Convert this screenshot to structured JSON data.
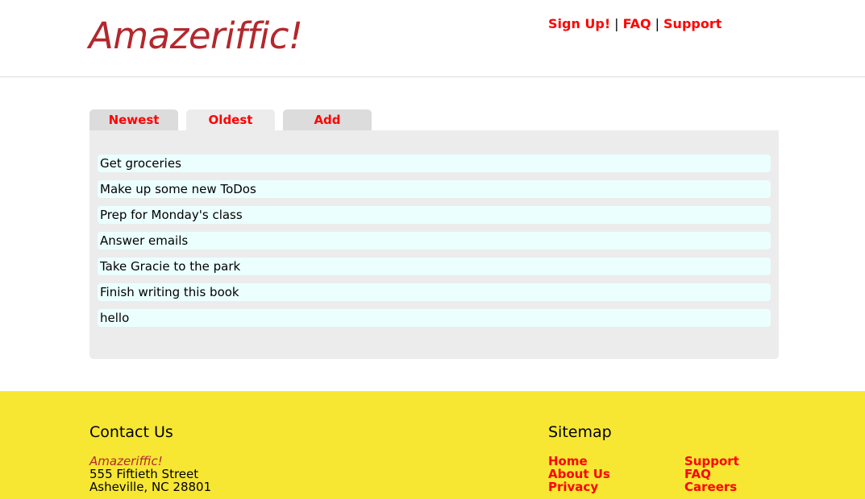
{
  "header": {
    "logo": "Amazeriffic!",
    "nav": {
      "signup": "Sign Up!",
      "separator": "|",
      "faq": "FAQ",
      "support": "Support"
    }
  },
  "tabs": [
    {
      "label": "Newest",
      "active": false
    },
    {
      "label": "Oldest",
      "active": true
    },
    {
      "label": "Add",
      "active": false
    }
  ],
  "todos": [
    "Get groceries",
    "Make up some new ToDos",
    "Prep for Monday's class",
    "Answer emails",
    "Take Gracie to the park",
    "Finish writing this book",
    "hello"
  ],
  "footer": {
    "contact": {
      "heading": "Contact Us",
      "brand": "Amazeriffic!",
      "street": "555 Fiftieth Street",
      "city": "Asheville, NC 28801"
    },
    "sitemap": {
      "heading": "Sitemap",
      "col1": [
        "Home",
        "About Us",
        "Privacy"
      ],
      "col2": [
        "Support",
        "FAQ",
        "Careers"
      ]
    }
  },
  "colors": {
    "brand": "#b3282d",
    "link": "#ff0000",
    "footer_bg": "#f7e733",
    "todo_bg": "#ecffff",
    "panel_bg": "#ececec"
  }
}
